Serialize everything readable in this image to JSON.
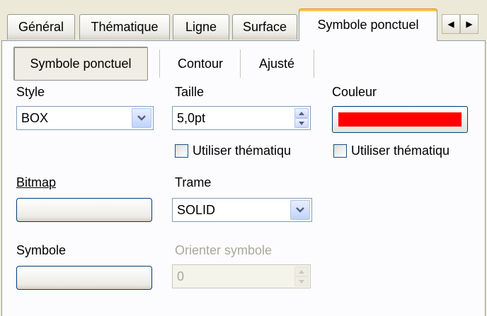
{
  "tabs": [
    {
      "label": "Général"
    },
    {
      "label": "Thématique"
    },
    {
      "label": "Ligne"
    },
    {
      "label": "Surface"
    },
    {
      "label": "Symbole ponctuel"
    }
  ],
  "subtabs": [
    {
      "label": "Symbole ponctuel"
    },
    {
      "label": "Contour"
    },
    {
      "label": "Ajusté"
    }
  ],
  "form": {
    "style": {
      "label": "Style",
      "value": "BOX"
    },
    "taille": {
      "label": "Taille",
      "value": "5,0pt",
      "thematic_label": "Utiliser thématiqu"
    },
    "couleur": {
      "label": "Couleur",
      "color": "#FF0000",
      "thematic_label": "Utiliser thématiqu"
    },
    "bitmap": {
      "label": "Bitmap"
    },
    "trame": {
      "label": "Trame",
      "value": "SOLID"
    },
    "symbole": {
      "label": "Symbole"
    },
    "orienter": {
      "label": "Orienter symbole",
      "value": "0"
    }
  }
}
